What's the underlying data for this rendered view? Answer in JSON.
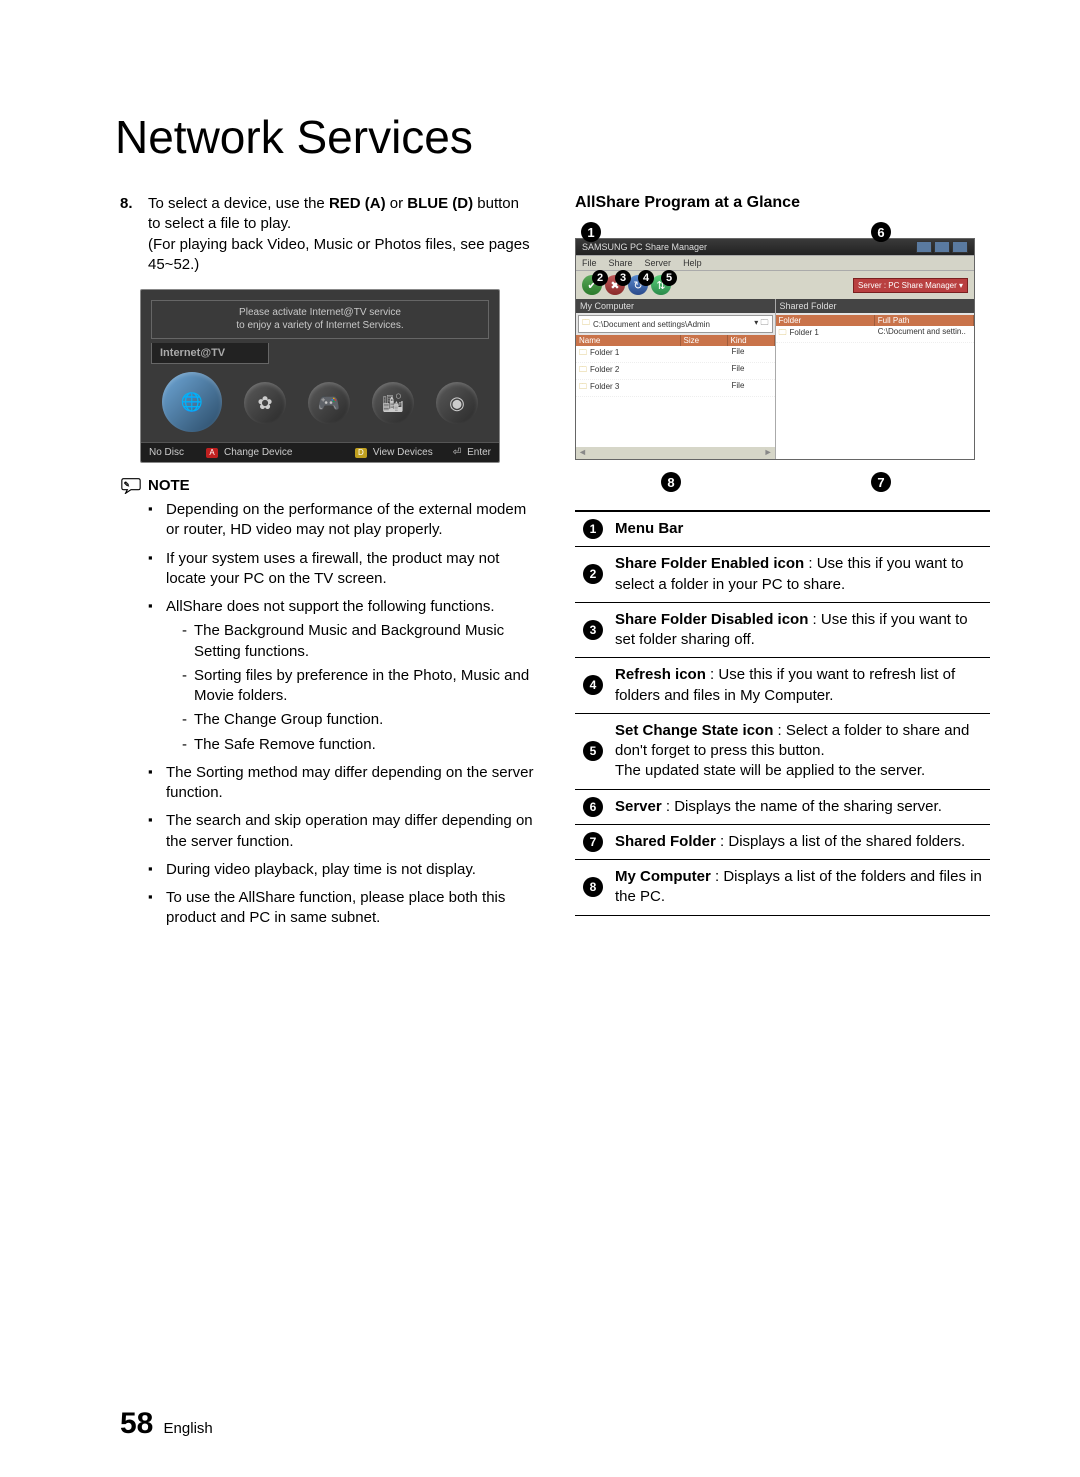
{
  "page_title": "Network Services",
  "left": {
    "step_num": "8.",
    "step_text_parts": {
      "a": "To select a device, use the ",
      "red": "RED (A)",
      "b": " or ",
      "blue": "BLUE (D)",
      "c": " button to select a file to play.",
      "line2": "(For playing back Video, Music or Photos files, see pages 45~52.)"
    },
    "tv": {
      "msg1": "Please activate Internet@TV service",
      "msg2": "to enjoy a variety of Internet Services.",
      "label": "Internet@TV",
      "bottom": {
        "nodisc": "No Disc",
        "pill_a": "A",
        "change": "Change Device",
        "pill_d": "D",
        "view": "View Devices",
        "enter_glyph": "⏎",
        "enter": "Enter"
      }
    },
    "note_label": "NOTE",
    "notes": [
      "Depending on the performance of the external modem or router, HD video may not play properly.",
      "If your system uses a firewall, the product may not locate your PC on the TV screen.",
      "AllShare does not support the following functions.",
      "The Sorting method may differ depending on the server function.",
      "The search and skip operation may differ depending on the server function.",
      "During video playback, play time is not display.",
      "To use the AllShare function, please place both this product and PC in same subnet."
    ],
    "subs": [
      "The Background Music and Background Music Setting functions.",
      "Sorting files by preference in the Photo, Music and Movie folders.",
      "The Change Group function.",
      "The Safe Remove function."
    ]
  },
  "right": {
    "heading": "AllShare Program at a Glance",
    "callouts": [
      "1",
      "2",
      "3",
      "4",
      "5",
      "6",
      "7",
      "8"
    ],
    "window": {
      "title": "SAMSUNG PC Share Manager",
      "menu": [
        "File",
        "Share",
        "Server",
        "Help"
      ],
      "server_label": "Server : PC Share Manager ▾",
      "left_pane": {
        "hdr": "My Computer",
        "path": "C:\\Document and settings\\Admin",
        "cols": [
          "Name",
          "Size",
          "Kind"
        ],
        "rows": [
          {
            "name": "Folder 1",
            "size": "",
            "kind": "File"
          },
          {
            "name": "Folder 2",
            "size": "",
            "kind": "File"
          },
          {
            "name": "Folder 3",
            "size": "",
            "kind": "File"
          }
        ]
      },
      "right_pane": {
        "hdr": "Shared Folder",
        "cols": [
          "Folder",
          "Full Path"
        ],
        "rows": [
          {
            "folder": "Folder 1",
            "path": "C:\\Document and settin.."
          }
        ]
      }
    },
    "table": [
      {
        "n": "1",
        "bold": "Menu Bar",
        "plain": ""
      },
      {
        "n": "2",
        "bold": "Share Folder Enabled icon",
        "plain": " : Use this if you want to select a folder in your PC to share."
      },
      {
        "n": "3",
        "bold": "Share Folder Disabled icon",
        "plain": " : Use this if you want to set folder sharing off."
      },
      {
        "n": "4",
        "bold": "Refresh icon",
        "plain": " : Use this if you want to refresh list of folders and files in My Computer."
      },
      {
        "n": "5",
        "bold": "Set Change State icon",
        "plain": " : Select a folder to share and don't forget to press this button.\nThe updated state will be applied to the server."
      },
      {
        "n": "6",
        "bold": "Server",
        "plain": " : Displays the name of the sharing server."
      },
      {
        "n": "7",
        "bold": "Shared Folder",
        "plain": " : Displays a list of the shared folders."
      },
      {
        "n": "8",
        "bold": "My Computer",
        "plain": " : Displays a list of the folders and files in the PC."
      }
    ]
  },
  "footer": {
    "page": "58",
    "lang": "English"
  }
}
